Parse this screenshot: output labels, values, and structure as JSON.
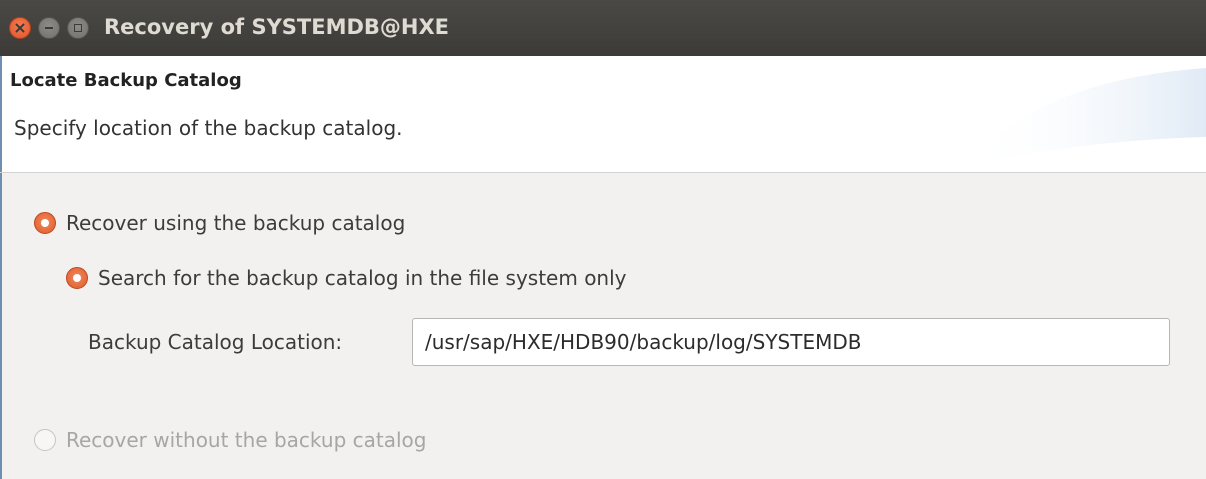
{
  "window": {
    "title": "Recovery of SYSTEMDB@HXE",
    "close_icon": "close-icon",
    "minimize_icon": "minimize-icon",
    "maximize_icon": "maximize-icon"
  },
  "header": {
    "title": "Locate Backup Catalog",
    "description": "Specify location of the backup catalog."
  },
  "options": {
    "recover_with_catalog": {
      "label": "Recover using the backup catalog",
      "checked": true,
      "enabled": true
    },
    "search_file_system": {
      "label": "Search for the backup catalog in the file system only",
      "checked": true,
      "enabled": true
    },
    "recover_without_catalog": {
      "label": "Recover without the backup catalog",
      "checked": false,
      "enabled": false
    }
  },
  "catalog_location": {
    "label": "Backup Catalog Location:",
    "value": "/usr/sap/HXE/HDB90/backup/log/SYSTEMDB"
  },
  "colors": {
    "titlebar": "#3c3b37",
    "radio_accent": "#e05a2b",
    "background": "#f2f1f0"
  }
}
